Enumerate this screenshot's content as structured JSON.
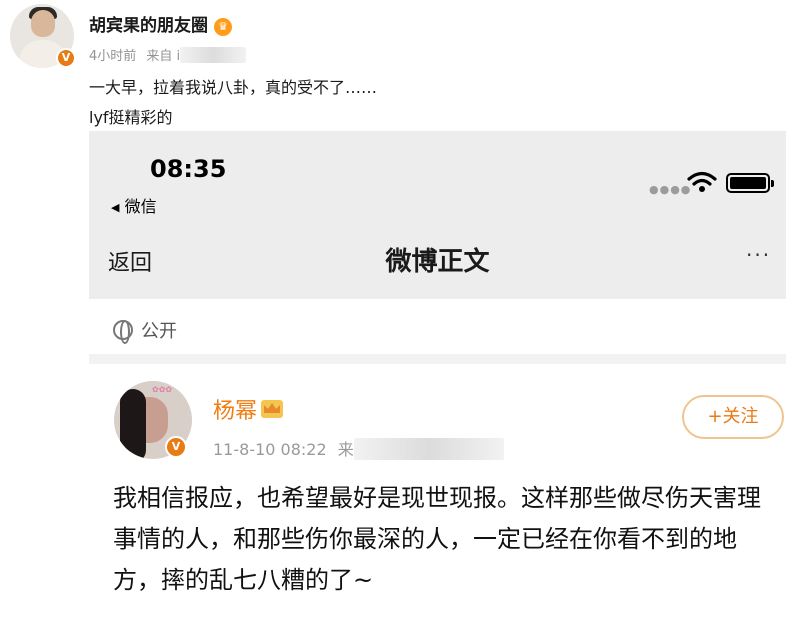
{
  "outer_post": {
    "author_name": "胡宾果的朋友圈",
    "time": "4小时前",
    "source_prefix": "来自 i",
    "text_lines": [
      "一大早，拉着我说八卦，真的受不了……",
      "lyf挺精彩的"
    ]
  },
  "screenshot": {
    "status_bar": {
      "time": "08:35",
      "back_app": "微信"
    },
    "nav_bar": {
      "back_label": "返回",
      "title": "微博正文",
      "more": "···"
    },
    "visibility": "公开",
    "post": {
      "author_name": "杨幂",
      "time": "11-8-10 08:22",
      "source_prefix": "来",
      "follow_label": "+关注",
      "text": "我相信报应，也希望最好是现世现报。这样那些做尽伤天害理事情的人，和那些伤你最深的人，一定已经在你看不到的地方，摔的乱七八糟的了~"
    }
  },
  "colors": {
    "accent_orange": "#ef7d13",
    "verified_badge": "#e87b14",
    "follow_border": "#f0c48e"
  }
}
